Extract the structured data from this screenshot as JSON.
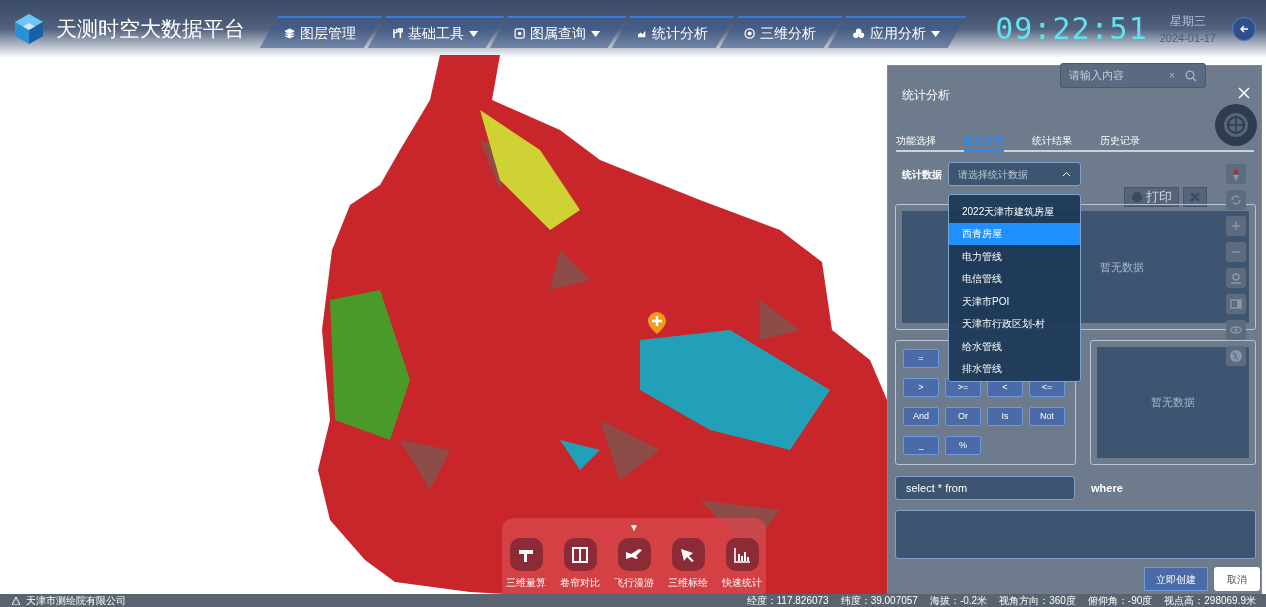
{
  "header": {
    "title": "天测时空大数据平台",
    "nav": [
      {
        "label": "图层管理",
        "dropdown": false
      },
      {
        "label": "基础工具",
        "dropdown": true
      },
      {
        "label": "图属查询",
        "dropdown": true
      },
      {
        "label": "统计分析",
        "dropdown": false
      },
      {
        "label": "三维分析",
        "dropdown": false
      },
      {
        "label": "应用分析",
        "dropdown": true
      }
    ],
    "clock": {
      "time": "09:22:51",
      "weekday": "星期三",
      "date": "2024-01-17"
    }
  },
  "map_search": {
    "placeholder": "请输入内容",
    "clear": "×"
  },
  "map_toolbar": [
    {
      "label": "打印"
    }
  ],
  "panel": {
    "title": "统计分析",
    "tabs": [
      {
        "label": "功能选择",
        "selected": false
      },
      {
        "label": "配置参数",
        "selected": true
      },
      {
        "label": "统计结果",
        "selected": false
      },
      {
        "label": "历史记录",
        "selected": false
      }
    ],
    "data_label": "统计数据",
    "data_select": {
      "placeholder": "请选择统计数据",
      "expanded": true
    },
    "options": [
      {
        "label": "2022天津市建筑房屋",
        "selected": false
      },
      {
        "label": "西青房屋",
        "selected": true
      },
      {
        "label": "电力管线",
        "selected": false
      },
      {
        "label": "电信管线",
        "selected": false
      },
      {
        "label": "天津市POI",
        "selected": false
      },
      {
        "label": "天津市行政区划-村",
        "selected": false
      },
      {
        "label": "给水管线",
        "selected": false
      },
      {
        "label": "排水管线",
        "selected": false
      }
    ],
    "fields_empty": "暂无数据",
    "operators": [
      [
        "="
      ],
      [
        ">",
        ">=",
        "<",
        "<="
      ],
      [
        "And",
        "Or",
        "Is",
        "Not"
      ],
      [
        "_",
        "%"
      ]
    ],
    "values_empty": "暂无数据",
    "sql_prefix": "select * from",
    "where_label": "where",
    "buttons": [
      {
        "label": "立即创建",
        "kind": "primary"
      },
      {
        "label": "取消",
        "kind": "secondary"
      }
    ]
  },
  "bottom_tools": {
    "toggle": "▼",
    "items": [
      {
        "label": "三维量算"
      },
      {
        "label": "卷帘对比"
      },
      {
        "label": "飞行漫游"
      },
      {
        "label": "三维标绘"
      },
      {
        "label": "快速统计"
      }
    ]
  },
  "status_bar": {
    "company": "天津市测绘院有限公司",
    "readouts": [
      "经度：117.826073",
      "纬度：39.007057",
      "海拔：-0.2米",
      "视角方向：360度",
      "俯仰角：-90度",
      "视点高：298069.9米"
    ]
  }
}
